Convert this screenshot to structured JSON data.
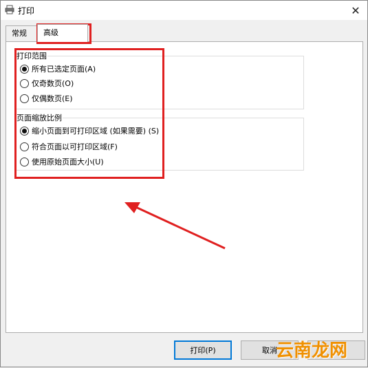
{
  "window": {
    "title": "打印"
  },
  "tabs": [
    {
      "label": "常规"
    },
    {
      "label": "高级"
    }
  ],
  "print_range": {
    "title": "打印范围",
    "options": [
      {
        "label": "所有已选定页面(A)",
        "checked": true
      },
      {
        "label": "仅奇数页(O)",
        "checked": false
      },
      {
        "label": "仅偶数页(E)",
        "checked": false
      }
    ]
  },
  "page_scaling": {
    "title": "页面缩放比例",
    "options": [
      {
        "label": "缩小页面到可打印区域 (如果需要) (S)",
        "checked": true
      },
      {
        "label": "符合页面以可打印区域(F)",
        "checked": false
      },
      {
        "label": "使用原始页面大小(U)",
        "checked": false
      }
    ]
  },
  "buttons": {
    "print": "打印(P)",
    "cancel": "取消"
  },
  "watermark": {
    "text": "云南龙网"
  },
  "colors": {
    "highlight": "#e02020",
    "default_button_border": "#0078d7"
  }
}
